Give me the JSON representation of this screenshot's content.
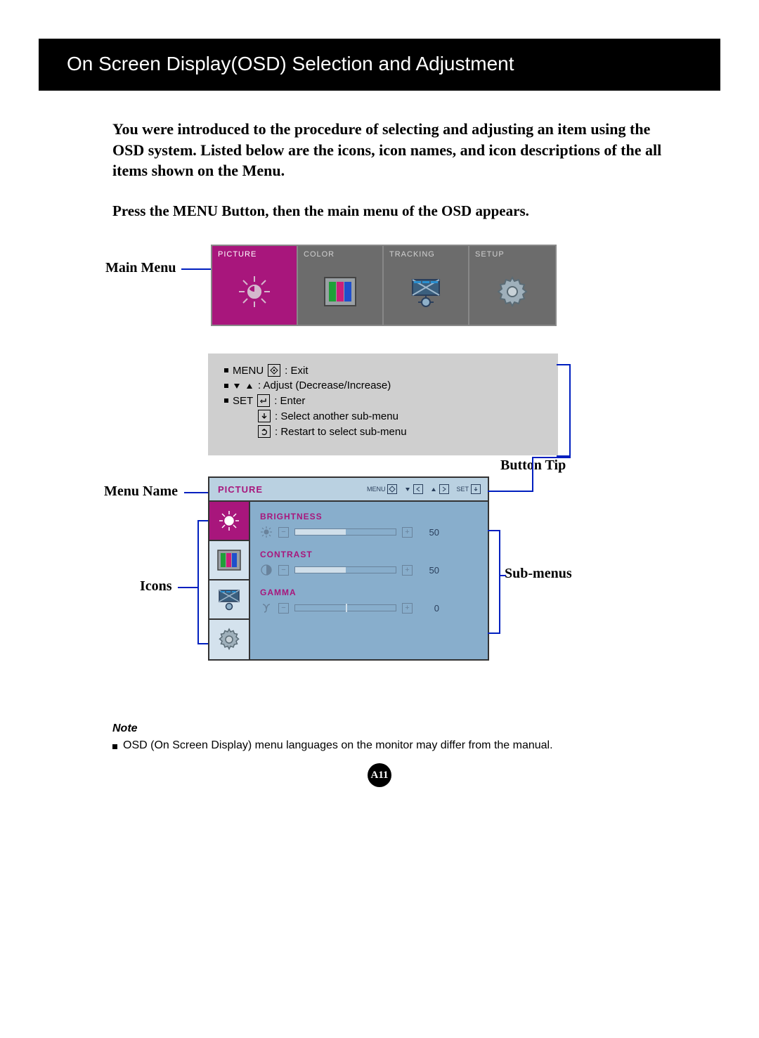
{
  "banner_title": "On Screen Display(OSD) Selection and Adjustment",
  "intro_paragraph": "You were introduced to the procedure of selecting and adjusting an item using the OSD system.  Listed below are the icons, icon names, and icon descriptions of the all items shown on the Menu.",
  "press_line": "Press the MENU Button, then the main menu of the OSD appears.",
  "labels": {
    "main_menu": "Main Menu",
    "menu_name": "Menu Name",
    "icons": "Icons",
    "button_tip": "Button Tip",
    "sub_menus": "Sub-menus"
  },
  "main_menu_tabs": [
    {
      "label": "PICTURE",
      "active": true,
      "icon": "brightness"
    },
    {
      "label": "COLOR",
      "active": false,
      "icon": "color-bars"
    },
    {
      "label": "TRACKING",
      "active": false,
      "icon": "tracking"
    },
    {
      "label": "SETUP",
      "active": false,
      "icon": "gear"
    }
  ],
  "button_tips": {
    "menu_label": "MENU",
    "menu_action": ": Exit",
    "adjust_label": ": Adjust (Decrease/Increase)",
    "set_label": "SET",
    "set_action": ": Enter",
    "down_action": ": Select another sub-menu",
    "restart_action": ": Restart to select sub-menu"
  },
  "osd_window": {
    "title": "PICTURE",
    "header_hints": {
      "menu": "MENU",
      "set": "SET"
    },
    "sidebar_icons": [
      "brightness",
      "color-bars",
      "tracking",
      "gear"
    ],
    "settings": [
      {
        "name": "BRIGHTNESS",
        "icon": "sun",
        "value": 50,
        "fill_percent": 50
      },
      {
        "name": "CONTRAST",
        "icon": "contrast",
        "value": 50,
        "fill_percent": 50
      },
      {
        "name": "GAMMA",
        "icon": "gamma",
        "value": 0,
        "fill_percent": 50
      }
    ]
  },
  "note": {
    "heading": "Note",
    "text": "OSD (On Screen Display) menu languages on the monitor may differ from the manual."
  },
  "page_number": "A11",
  "chart_data": {
    "type": "table",
    "title": "OSD Picture settings",
    "rows": [
      {
        "setting": "BRIGHTNESS",
        "value": 50
      },
      {
        "setting": "CONTRAST",
        "value": 50
      },
      {
        "setting": "GAMMA",
        "value": 0
      }
    ]
  }
}
